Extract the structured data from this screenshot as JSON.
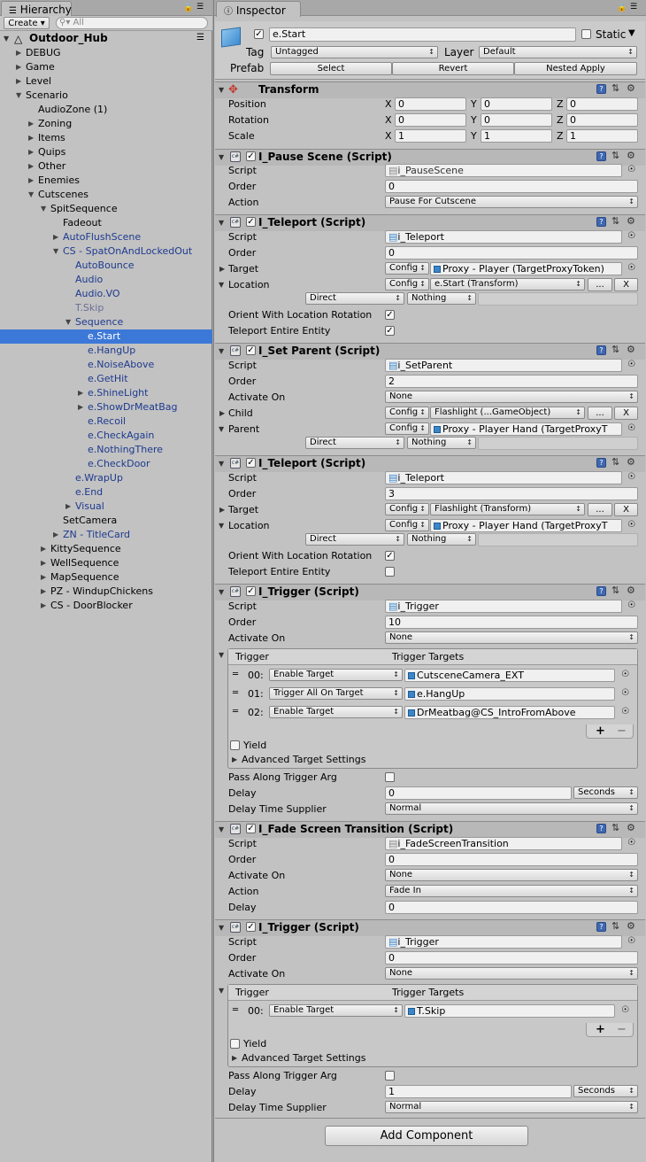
{
  "hierarchy": {
    "tab_label": "Hierarchy",
    "create_label": "Create",
    "search_placeholder": "All",
    "scene_name": "Outdoor_Hub",
    "items": [
      {
        "label": "DEBUG",
        "depth": 1,
        "fold": "closed",
        "style": "normal"
      },
      {
        "label": "Game",
        "depth": 1,
        "fold": "closed",
        "style": "normal"
      },
      {
        "label": "Level",
        "depth": 1,
        "fold": "closed",
        "style": "normal"
      },
      {
        "label": "Scenario",
        "depth": 1,
        "fold": "open",
        "style": "normal"
      },
      {
        "label": "AudioZone (1)",
        "depth": 2,
        "fold": "none",
        "style": "normal"
      },
      {
        "label": "Zoning",
        "depth": 2,
        "fold": "closed",
        "style": "normal"
      },
      {
        "label": "Items",
        "depth": 2,
        "fold": "closed",
        "style": "normal"
      },
      {
        "label": "Quips",
        "depth": 2,
        "fold": "closed",
        "style": "normal"
      },
      {
        "label": "Other",
        "depth": 2,
        "fold": "closed",
        "style": "normal"
      },
      {
        "label": "Enemies",
        "depth": 2,
        "fold": "closed",
        "style": "normal"
      },
      {
        "label": "Cutscenes",
        "depth": 2,
        "fold": "open",
        "style": "normal"
      },
      {
        "label": "SpitSequence",
        "depth": 3,
        "fold": "open",
        "style": "normal"
      },
      {
        "label": "Fadeout",
        "depth": 4,
        "fold": "none",
        "style": "normal"
      },
      {
        "label": "AutoFlushScene",
        "depth": 4,
        "fold": "closed",
        "style": "blue"
      },
      {
        "label": "CS - SpatOnAndLockedOut",
        "depth": 4,
        "fold": "open",
        "style": "blue"
      },
      {
        "label": "AutoBounce",
        "depth": 5,
        "fold": "none",
        "style": "blue"
      },
      {
        "label": "Audio",
        "depth": 5,
        "fold": "none",
        "style": "blue"
      },
      {
        "label": "Audio.VO",
        "depth": 5,
        "fold": "none",
        "style": "blue"
      },
      {
        "label": "T.Skip",
        "depth": 5,
        "fold": "none",
        "style": "grey"
      },
      {
        "label": "Sequence",
        "depth": 5,
        "fold": "open",
        "style": "blue"
      },
      {
        "label": "e.Start",
        "depth": 6,
        "fold": "none",
        "style": "selected"
      },
      {
        "label": "e.HangUp",
        "depth": 6,
        "fold": "none",
        "style": "blue"
      },
      {
        "label": "e.NoiseAbove",
        "depth": 6,
        "fold": "none",
        "style": "blue"
      },
      {
        "label": "e.GetHit",
        "depth": 6,
        "fold": "none",
        "style": "blue"
      },
      {
        "label": "e.ShineLight",
        "depth": 6,
        "fold": "closed",
        "style": "blue"
      },
      {
        "label": "e.ShowDrMeatBag",
        "depth": 6,
        "fold": "closed",
        "style": "blue"
      },
      {
        "label": "e.Recoil",
        "depth": 6,
        "fold": "none",
        "style": "blue"
      },
      {
        "label": "e.CheckAgain",
        "depth": 6,
        "fold": "none",
        "style": "blue"
      },
      {
        "label": "e.NothingThere",
        "depth": 6,
        "fold": "none",
        "style": "blue"
      },
      {
        "label": "e.CheckDoor",
        "depth": 6,
        "fold": "none",
        "style": "blue"
      },
      {
        "label": "e.WrapUp",
        "depth": 5,
        "fold": "none",
        "style": "blue"
      },
      {
        "label": "e.End",
        "depth": 5,
        "fold": "none",
        "style": "blue"
      },
      {
        "label": "Visual",
        "depth": 5,
        "fold": "closed",
        "style": "blue"
      },
      {
        "label": "SetCamera",
        "depth": 4,
        "fold": "none",
        "style": "normal"
      },
      {
        "label": "ZN - TitleCard",
        "depth": 4,
        "fold": "closed",
        "style": "blue"
      },
      {
        "label": "KittySequence",
        "depth": 3,
        "fold": "closed",
        "style": "normal"
      },
      {
        "label": "WellSequence",
        "depth": 3,
        "fold": "closed",
        "style": "normal"
      },
      {
        "label": "MapSequence",
        "depth": 3,
        "fold": "closed",
        "style": "normal"
      },
      {
        "label": "PZ - WindupChickens",
        "depth": 3,
        "fold": "closed",
        "style": "normal"
      },
      {
        "label": "CS - DoorBlocker",
        "depth": 3,
        "fold": "closed",
        "style": "normal"
      }
    ]
  },
  "inspector": {
    "tab_label": "Inspector",
    "object": {
      "name": "e.Start",
      "static_label": "Static",
      "tag_label": "Tag",
      "tag_value": "Untagged",
      "layer_label": "Layer",
      "layer_value": "Default",
      "prefab_label": "Prefab",
      "select_label": "Select",
      "revert_label": "Revert",
      "nested_apply_label": "Nested Apply"
    },
    "transform": {
      "title": "Transform",
      "position_label": "Position",
      "rotation_label": "Rotation",
      "scale_label": "Scale",
      "axis_x": "X",
      "axis_y": "Y",
      "axis_z": "Z",
      "position": [
        "0",
        "0",
        "0"
      ],
      "rotation": [
        "0",
        "0",
        "0"
      ],
      "scale": [
        "1",
        "1",
        "1"
      ]
    },
    "labels": {
      "script": "Script",
      "order": "Order",
      "action": "Action",
      "target": "Target",
      "location": "Location",
      "activate_on": "Activate On",
      "child": "Child",
      "parent": "Parent",
      "orient": "Orient With Location Rotation",
      "teleport_entire": "Teleport Entire Entity",
      "trigger": "Trigger",
      "trigger_targets": "Trigger Targets",
      "yield": "Yield",
      "advanced": "Advanced Target Settings",
      "pass_along": "Pass Along Trigger Arg",
      "delay": "Delay",
      "delay_supplier": "Delay Time Supplier",
      "config": "Config",
      "ellipsis": "...",
      "x_btn": "X",
      "plus": "+",
      "minus": "−"
    },
    "pause_scene": {
      "title": "I_Pause Scene (Script)",
      "script": "i_PauseScene",
      "order": "0",
      "action": "Pause For Cutscene"
    },
    "teleport1": {
      "title": "I_Teleport (Script)",
      "script": "i_Teleport",
      "order": "0",
      "target_value": "Proxy - Player (TargetProxyToken)",
      "location_value": "e.Start (Transform)",
      "dir_value": "Direct",
      "nothing_value": "Nothing"
    },
    "set_parent": {
      "title": "I_Set Parent (Script)",
      "script": "i_SetParent",
      "order": "2",
      "activate_on": "None",
      "child_value": "Flashlight (...GameObject)",
      "parent_value": "Proxy - Player Hand (TargetProxyT",
      "dir_value": "Direct",
      "nothing_value": "Nothing"
    },
    "teleport2": {
      "title": "I_Teleport (Script)",
      "script": "i_Teleport",
      "order": "3",
      "target_value": "Flashlight (Transform)",
      "location_value": "Proxy - Player Hand (TargetProxyT",
      "dir_value": "Direct",
      "nothing_value": "Nothing"
    },
    "trigger1": {
      "title": "I_Trigger (Script)",
      "script": "i_Trigger",
      "order": "10",
      "activate_on": "None",
      "rows": [
        {
          "idx": "00:",
          "mode": "Enable Target",
          "target": "CutsceneCamera_EXT"
        },
        {
          "idx": "01:",
          "mode": "Trigger All On Target",
          "target": "e.HangUp"
        },
        {
          "idx": "02:",
          "mode": "Enable Target",
          "target": "DrMeatbag@CS_IntroFromAbove"
        }
      ],
      "delay": "0",
      "delay_unit": "Seconds",
      "supplier": "Normal"
    },
    "fade": {
      "title": "I_Fade Screen Transition (Script)",
      "script": "i_FadeScreenTransition",
      "order": "0",
      "activate_on": "None",
      "action": "Fade In",
      "delay": "0"
    },
    "trigger2": {
      "title": "I_Trigger (Script)",
      "script": "i_Trigger",
      "order": "0",
      "activate_on": "None",
      "rows": [
        {
          "idx": "00:",
          "mode": "Enable Target",
          "target": "T.Skip"
        }
      ],
      "delay": "1",
      "delay_unit": "Seconds",
      "supplier": "Normal"
    },
    "add_component": "Add Component"
  }
}
